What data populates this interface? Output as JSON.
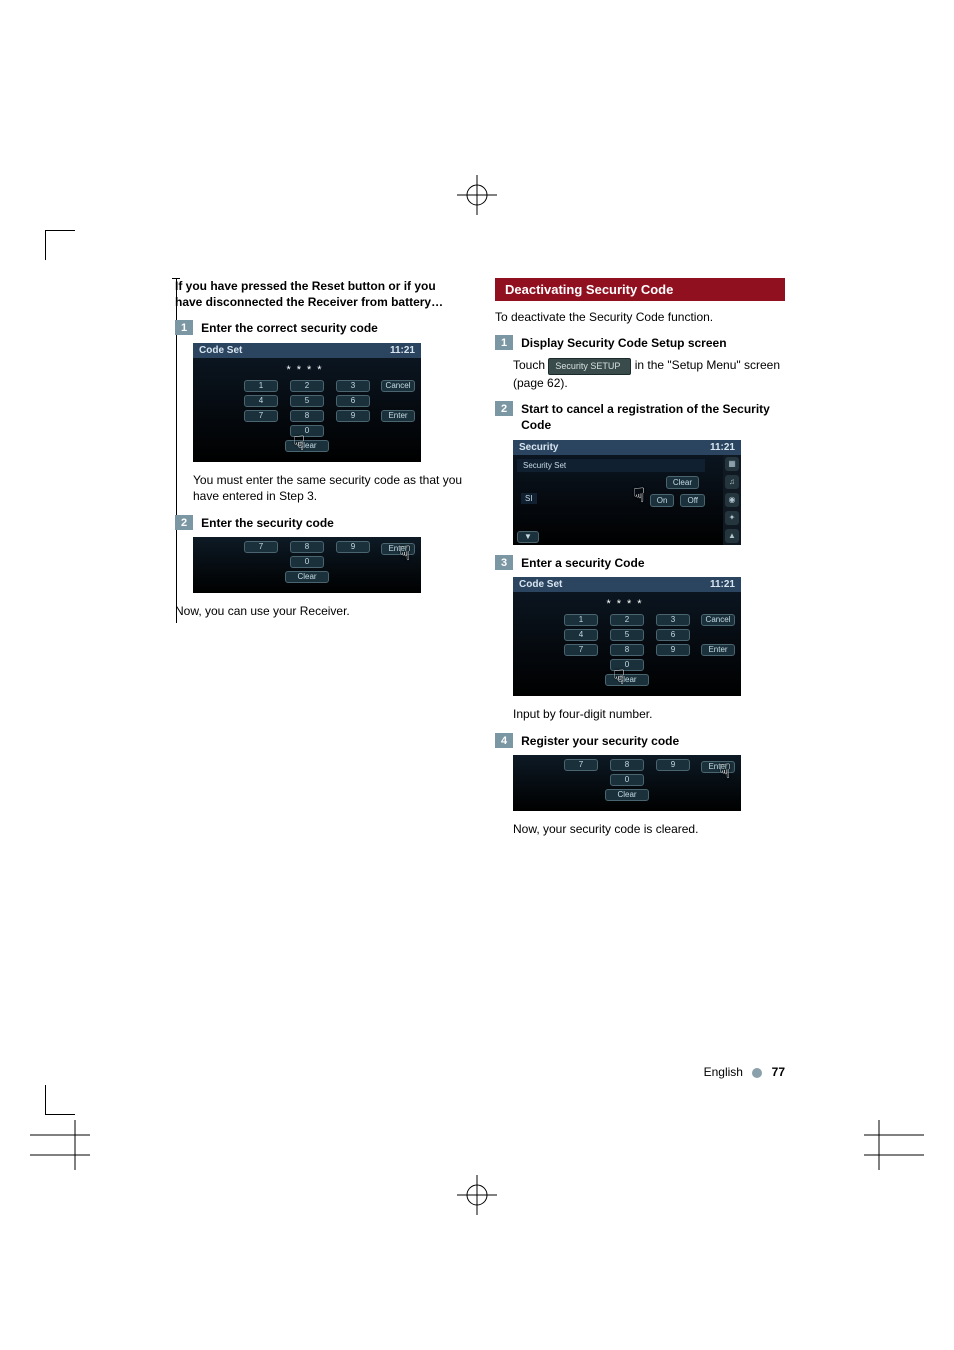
{
  "left": {
    "intro": "If you have pressed the Reset button or if you have disconnected the Receiver from battery…",
    "steps": {
      "one": {
        "num": "1",
        "title": "Enter the correct security code",
        "note": "You must enter the same security code as that you have entered in Step 3."
      },
      "two": {
        "num": "2",
        "title": "Enter the security code"
      }
    },
    "outro": "Now, you can use your Receiver."
  },
  "right": {
    "section_title": "Deactivating Security Code",
    "intro": "To deactivate the Security Code function.",
    "steps": {
      "one": {
        "num": "1",
        "title": "Display Security Code Setup screen",
        "body_pre": "Touch ",
        "button_label": "Security SETUP",
        "body_post": " in the \"Setup Menu\" screen (page 62)."
      },
      "two": {
        "num": "2",
        "title": "Start to cancel a registration of the Security Code"
      },
      "three": {
        "num": "3",
        "title": "Enter a security Code",
        "note": "Input by four-digit number."
      },
      "four": {
        "num": "4",
        "title": "Register your security code",
        "note": "Now, your security code is cleared."
      }
    }
  },
  "screenshots": {
    "codeset": {
      "title": "Code Set",
      "time": "11:21",
      "code_display": "****",
      "keys": [
        "1",
        "2",
        "3",
        "4",
        "5",
        "6",
        "7",
        "8",
        "9",
        "0"
      ],
      "cancel": "Cancel",
      "enter": "Enter",
      "clear": "Clear"
    },
    "security": {
      "title": "Security",
      "time": "11:21",
      "row_label": "Security Set",
      "si": "SI",
      "on_off_left": "On",
      "on_off_right": "Off",
      "clear": "Clear"
    }
  },
  "footer": {
    "lang": "English",
    "page": "77"
  }
}
